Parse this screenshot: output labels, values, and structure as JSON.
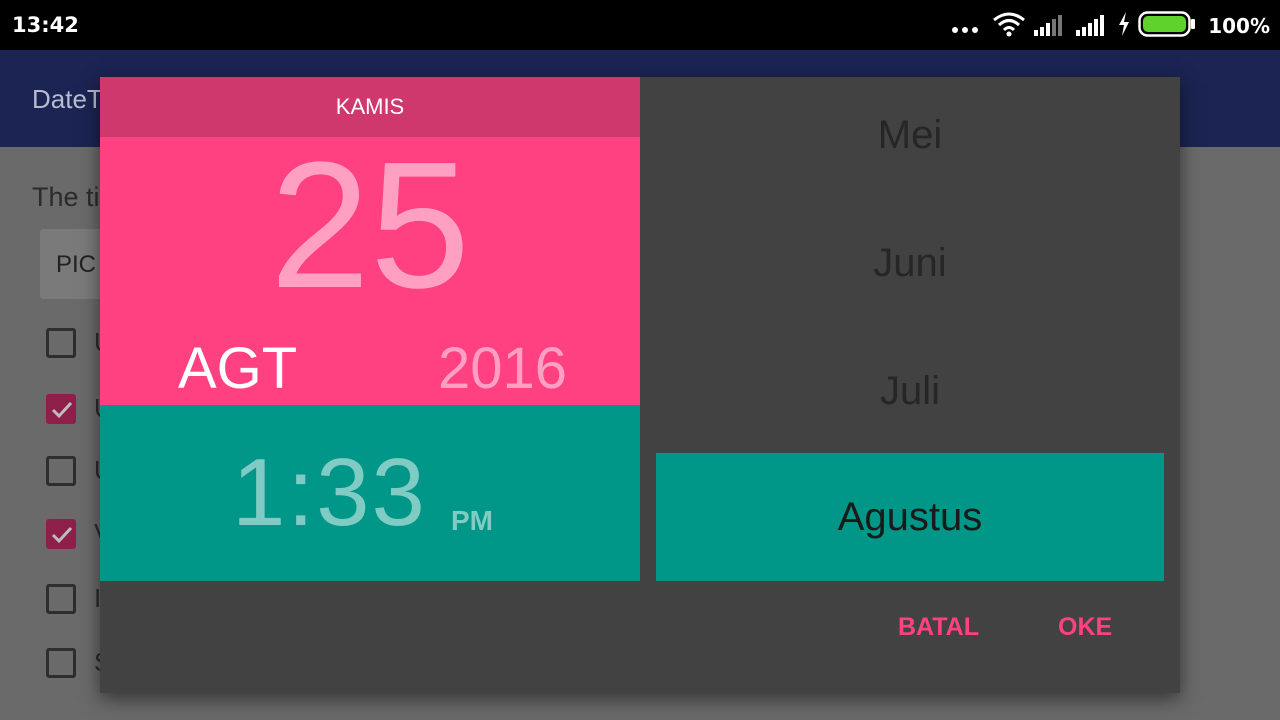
{
  "status_bar": {
    "time": "13:42",
    "battery_percent": "100%",
    "icons": [
      "more-dots-icon",
      "wifi-icon",
      "signal-icon",
      "signal-icon",
      "charging-icon",
      "battery-icon"
    ]
  },
  "app": {
    "title": "DateT",
    "content_text": "The ti",
    "pick_button_label": "PIC",
    "checkboxes": [
      {
        "checked": false,
        "label": "U"
      },
      {
        "checked": true,
        "label": "U"
      },
      {
        "checked": false,
        "label": "U"
      },
      {
        "checked": true,
        "label": "V"
      },
      {
        "checked": false,
        "label": "I"
      },
      {
        "checked": false,
        "label": "S"
      }
    ]
  },
  "dialog": {
    "day_name": "KAMIS",
    "day_number": "25",
    "month_short": "AGT",
    "year": "2016",
    "time": "1:33",
    "ampm": "PM",
    "months": [
      {
        "label": "Mei",
        "selected": false
      },
      {
        "label": "Juni",
        "selected": false
      },
      {
        "label": "Juli",
        "selected": false
      },
      {
        "label": "Agustus",
        "selected": true
      }
    ],
    "cancel_label": "BATAL",
    "ok_label": "OKE"
  },
  "colors": {
    "accent": "#ff4081",
    "accent_dark": "#cf386c",
    "teal": "#009688",
    "dialog_bg": "#424242",
    "appbar": "#1b2452"
  }
}
